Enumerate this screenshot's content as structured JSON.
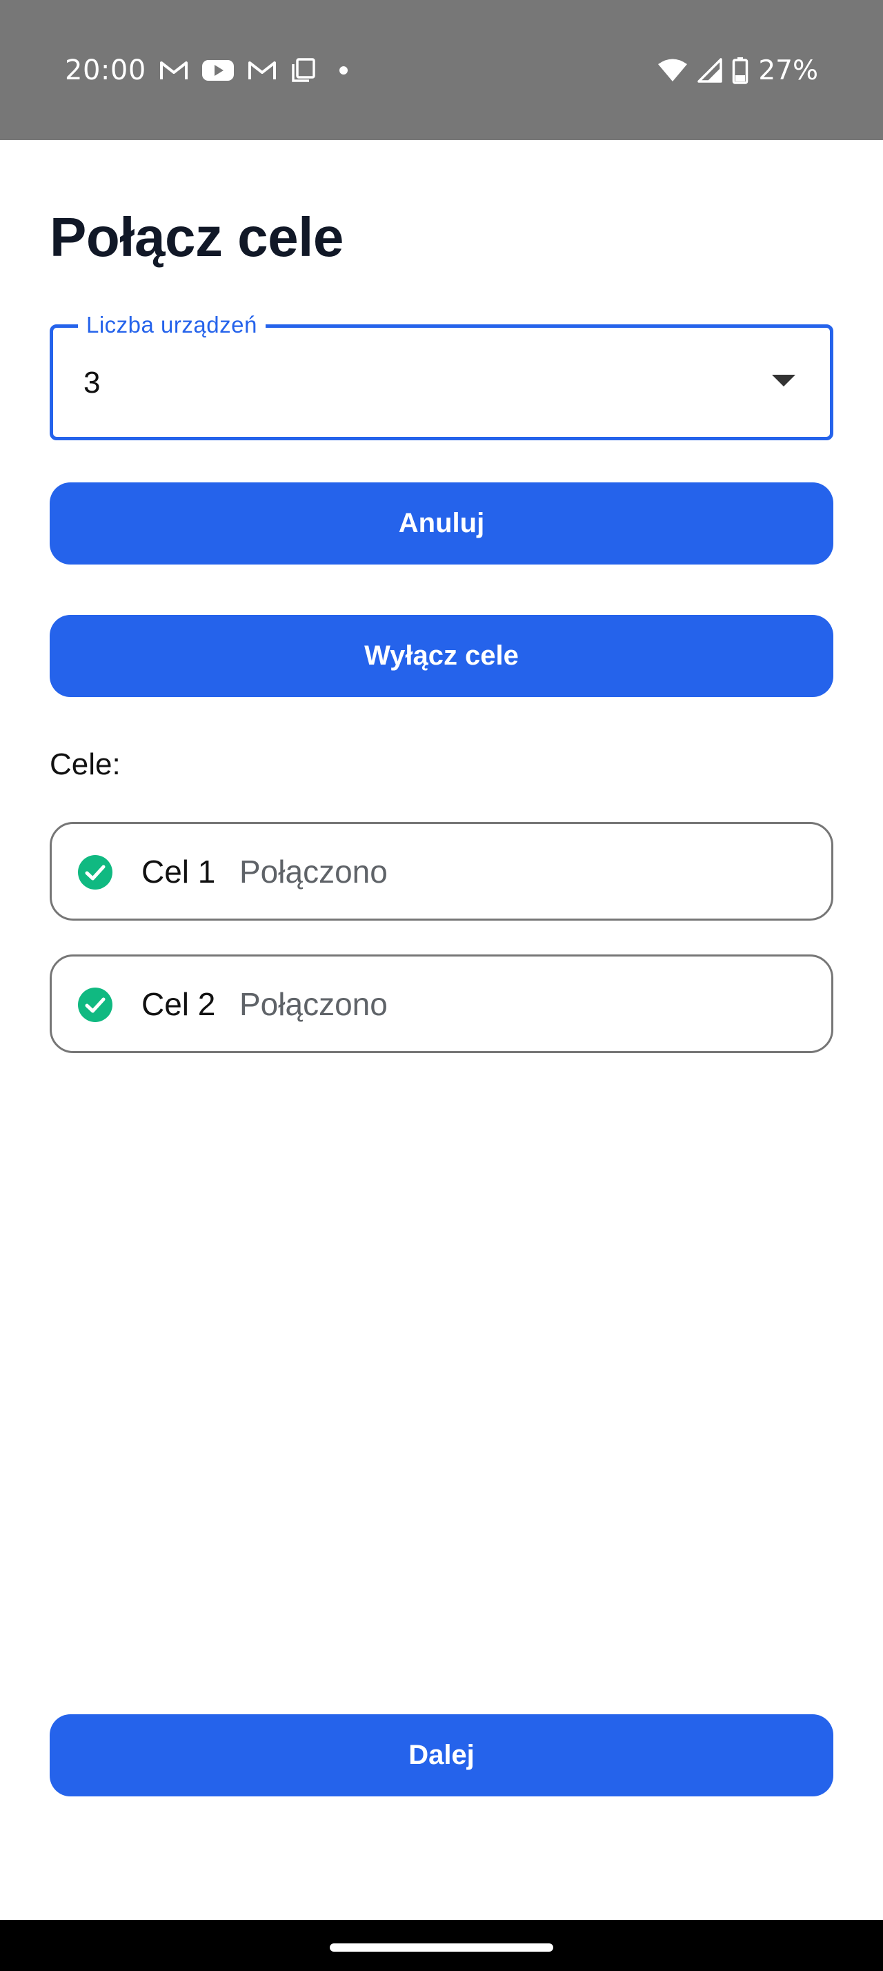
{
  "status_bar": {
    "time": "20:00",
    "battery": "27%",
    "notification_icons": [
      "gmail-icon",
      "youtube-icon",
      "gmail-icon",
      "copy-icon",
      "dot-icon"
    ],
    "system_icons": [
      "wifi-icon",
      "signal-icon",
      "battery-icon"
    ]
  },
  "page": {
    "title": "Połącz cele"
  },
  "device_count": {
    "label": "Liczba urządzeń",
    "value": "3"
  },
  "buttons": {
    "cancel": "Anuluj",
    "disable_targets": "Wyłącz cele",
    "next": "Dalej"
  },
  "targets_section": {
    "label": "Cele:",
    "items": [
      {
        "name": "Cel 1",
        "status": "Połączono"
      },
      {
        "name": "Cel 2",
        "status": "Połączono"
      }
    ]
  },
  "colors": {
    "accent": "#2563eb",
    "success": "#10b981",
    "status_bar": "#777777"
  }
}
